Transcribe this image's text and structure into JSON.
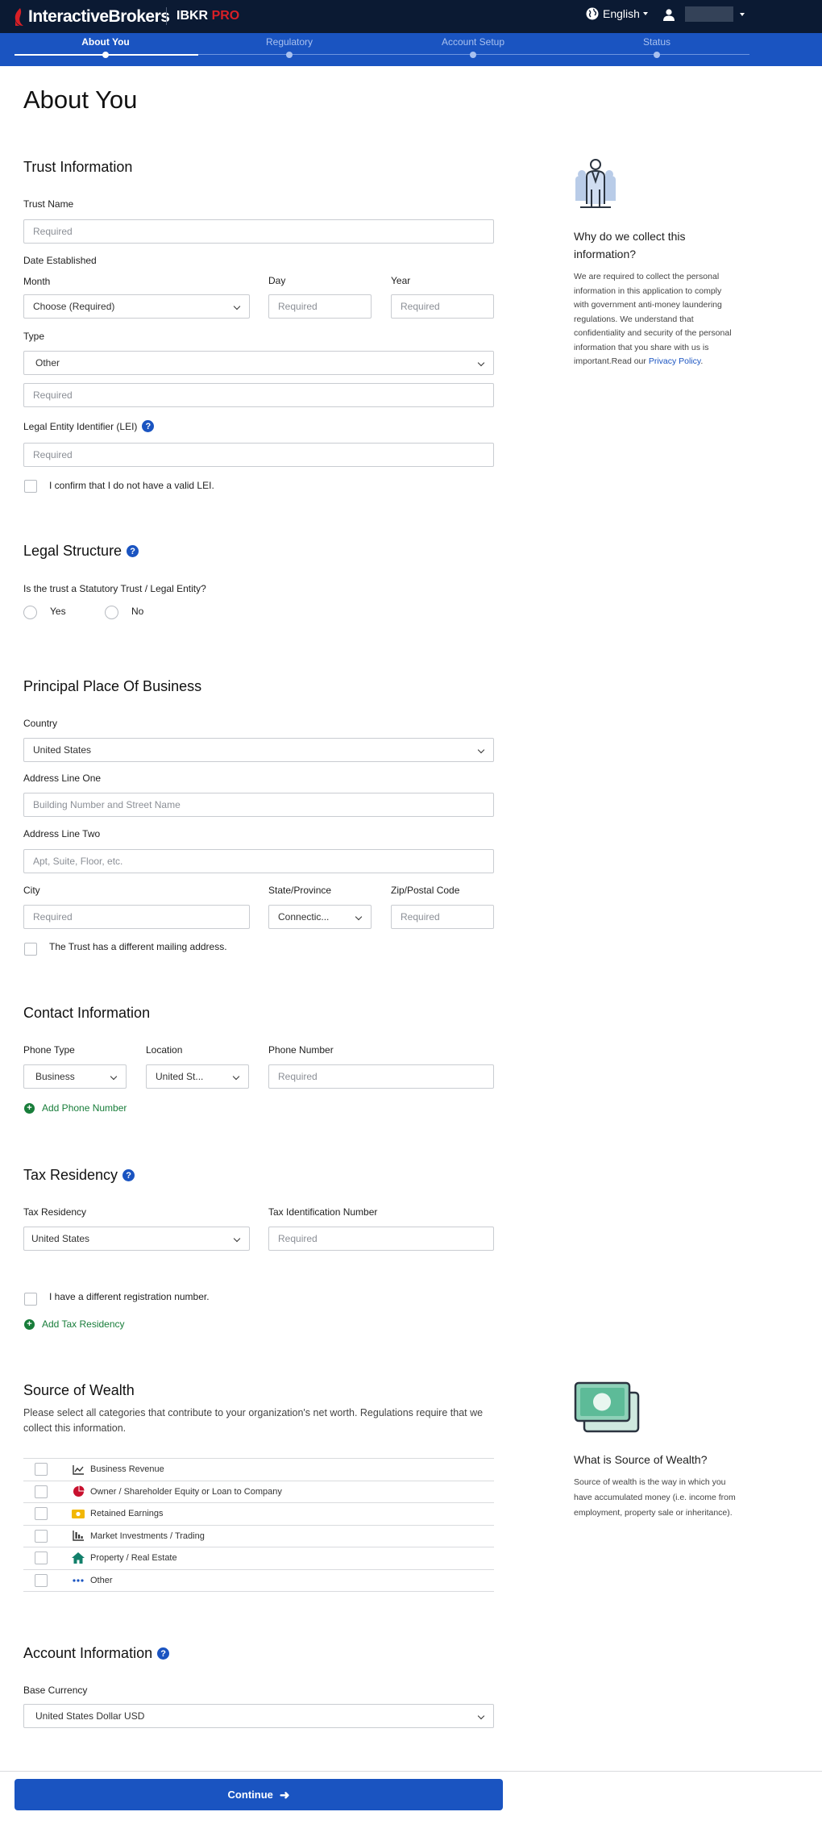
{
  "nav": {
    "brand": "InteractiveBrokers",
    "product_prefix": "IBKR ",
    "product_suffix": "PRO",
    "language": "English"
  },
  "steps": [
    {
      "label": "About You",
      "active": true
    },
    {
      "label": "Regulatory",
      "active": false
    },
    {
      "label": "Account Setup",
      "active": false
    },
    {
      "label": "Status",
      "active": false
    }
  ],
  "page_title": "About You",
  "trust": {
    "heading": "Trust Information",
    "name_label": "Trust Name",
    "name_placeholder": "Required",
    "date_label": "Date Established",
    "month_label": "Month",
    "month_value": "Choose (Required)",
    "day_label": "Day",
    "day_placeholder": "Required",
    "year_label": "Year",
    "year_placeholder": "Required",
    "type_label": "Type",
    "type_value": "Other",
    "type_other_placeholder": "Required",
    "lei_label": "Legal Entity Identifier (LEI)",
    "lei_placeholder": "Required",
    "lei_confirm": "I confirm that I do not have a valid LEI."
  },
  "side_why": {
    "title": "Why do we collect this information?",
    "body": "We are required to collect the personal information in this application to comply with government anti-money laundering regulations. We understand that confidentiality and security of the personal information that you share with us is important.Read our ",
    "link": "Privacy Policy",
    "after_link": "."
  },
  "legal": {
    "heading": "Legal Structure",
    "question": "Is the trust a Statutory Trust / Legal Entity?",
    "yes": "Yes",
    "no": "No"
  },
  "business": {
    "heading": "Principal Place Of Business",
    "country_label": "Country",
    "country_value": "United States",
    "addr1_label": "Address Line One",
    "addr1_placeholder": "Building Number and Street Name",
    "addr2_label": "Address Line Two",
    "addr2_placeholder": "Apt, Suite, Floor, etc.",
    "city_label": "City",
    "city_placeholder": "Required",
    "state_label": "State/Province",
    "state_value": "Connectic...",
    "zip_label": "Zip/Postal Code",
    "zip_placeholder": "Required",
    "mailing": "The Trust has a different mailing address."
  },
  "contact": {
    "heading": "Contact Information",
    "phone_type_label": "Phone Type",
    "phone_type_value": "Business",
    "location_label": "Location",
    "location_value": "United St...",
    "number_label": "Phone Number",
    "number_placeholder": "Required",
    "add_phone": "Add Phone Number"
  },
  "tax": {
    "heading": "Tax Residency",
    "residency_label": "Tax Residency",
    "residency_value": "United States",
    "tin_label": "Tax Identification Number",
    "tin_placeholder": "Required",
    "diff_reg": "I have a different registration number.",
    "add_tax": "Add Tax Residency"
  },
  "wealth": {
    "heading": "Source of Wealth",
    "desc": "Please select all categories that contribute to your organization's net worth. Regulations require that we collect this information.",
    "items": [
      {
        "label": "Business Revenue",
        "icon": "line-chart-icon"
      },
      {
        "label": "Owner / Shareholder Equity or Loan to Company",
        "icon": "pie-chart-icon"
      },
      {
        "label": "Retained Earnings",
        "icon": "cash-icon"
      },
      {
        "label": "Market Investments / Trading",
        "icon": "bar-chart-icon"
      },
      {
        "label": "Property / Real Estate",
        "icon": "house-icon"
      },
      {
        "label": "Other",
        "icon": "ellipsis-icon"
      }
    ]
  },
  "side_wealth": {
    "title": "What is Source of Wealth?",
    "body": "Source of wealth is the way in which you have accumulated money (i.e. income from employment, property sale or inheritance)."
  },
  "account": {
    "heading": "Account Information",
    "currency_label": "Base Currency",
    "currency_value": "United States Dollar USD"
  },
  "continue_label": "Continue",
  "colors": {
    "nav_bg": "#0b1a33",
    "step_bg": "#1a54c1",
    "accent": "#1a54c1",
    "brand_red": "#d81f26",
    "link_green": "#187d3a"
  }
}
